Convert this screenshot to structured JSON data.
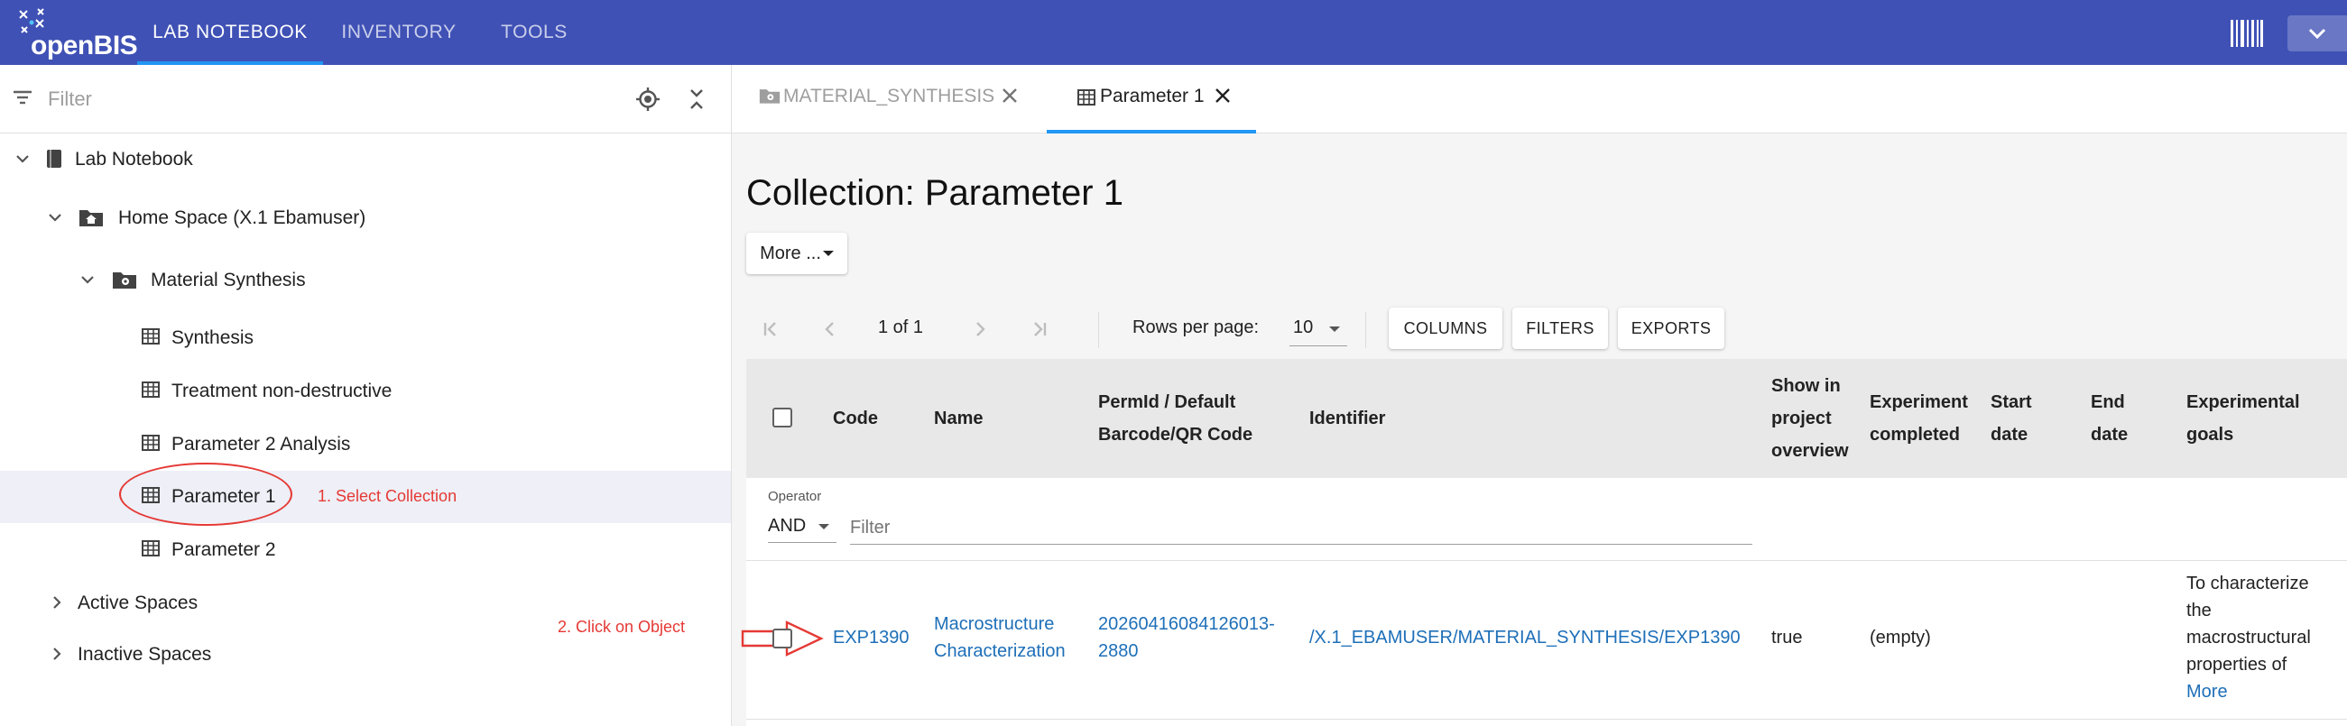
{
  "app": {
    "logo_text": "openBIS",
    "nav_tabs": [
      {
        "label": "LAB NOTEBOOK",
        "active": true
      },
      {
        "label": "INVENTORY",
        "active": false
      },
      {
        "label": "TOOLS",
        "active": false
      }
    ],
    "accent_color": "#3f51b5",
    "indicator_color": "#2196f3"
  },
  "sidebar": {
    "filter_placeholder": "Filter",
    "tree": [
      {
        "label": "Lab Notebook",
        "icon": "notebook-icon",
        "expanded": true
      },
      {
        "label": "Home Space (X.1 Ebamuser)",
        "icon": "home-folder-icon",
        "expanded": true
      },
      {
        "label": "Material Synthesis",
        "icon": "project-folder-icon",
        "expanded": true
      },
      {
        "label": "Synthesis",
        "icon": "collection-table-icon"
      },
      {
        "label": "Treatment non-destructive",
        "icon": "collection-table-icon"
      },
      {
        "label": "Parameter 2 Analysis",
        "icon": "collection-table-icon"
      },
      {
        "label": "Parameter 1",
        "icon": "collection-table-icon",
        "selected": true
      },
      {
        "label": "Parameter 2",
        "icon": "collection-table-icon"
      },
      {
        "label": "Active Spaces",
        "icon": "chevron-right-icon",
        "expanded": false
      },
      {
        "label": "Inactive Spaces",
        "icon": "chevron-right-icon",
        "expanded": false
      }
    ]
  },
  "annotations": {
    "step1": "1. Select Collection",
    "step2": "2. Click on Object",
    "color": "#e53935"
  },
  "tabs": [
    {
      "label": "MATERIAL_SYNTHESIS",
      "icon": "project-folder-icon",
      "active": false
    },
    {
      "label": "Parameter 1",
      "icon": "collection-table-icon",
      "active": true
    }
  ],
  "main": {
    "title": "Collection: Parameter 1",
    "more_label": "More ...",
    "pager": {
      "page_info": "1 of 1",
      "rows_label": "Rows per page:",
      "rows_value": "10"
    },
    "toolbar": {
      "columns": "COLUMNS",
      "filters": "FILTERS",
      "exports": "EXPORTS"
    },
    "columns": {
      "code": "Code",
      "name": "Name",
      "permid_1": "PermId / Default",
      "permid_2": "Barcode/QR Code",
      "identifier": "Identifier",
      "show_1": "Show in",
      "show_2": "project",
      "show_3": "overview",
      "completed_1": "Experiment",
      "completed_2": "completed",
      "start_1": "Start",
      "start_2": "date",
      "end_1": "End",
      "end_2": "date",
      "goals_1": "Experimental",
      "goals_2": "goals"
    },
    "filter_row": {
      "operator_label": "Operator",
      "operator_value": "AND",
      "filter_placeholder": "Filter"
    },
    "rows": [
      {
        "code": "EXP1390",
        "name_1": "Macrostructure",
        "name_2": "Characterization",
        "permid_1": "20260416084126013-",
        "permid_2": "2880",
        "identifier": "/X.1_EBAMUSER/MATERIAL_SYNTHESIS/EXP1390",
        "show": "true",
        "completed": "(empty)",
        "goals_1": "To characterize",
        "goals_2": "the",
        "goals_3": "macrostructural",
        "goals_4": "properties of",
        "goals_more": "More"
      }
    ]
  }
}
